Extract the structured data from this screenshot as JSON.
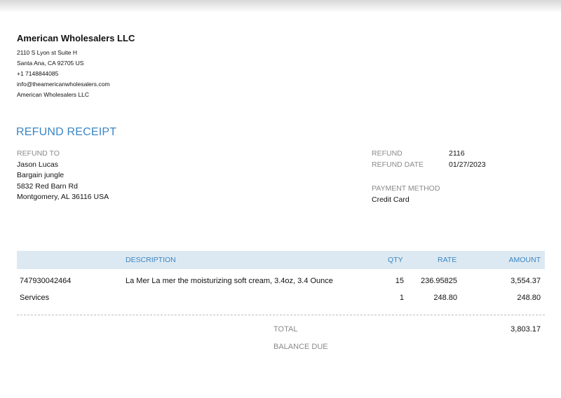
{
  "company": {
    "name": "American Wholesalers LLC",
    "address1": "2110 S Lyon st Suite H",
    "address2": "Santa Ana, CA  92705 US",
    "phone": "+1 7148844085",
    "email": "info@theamericanwholesalers.com",
    "name2": "American Wholesalers LLC"
  },
  "document": {
    "title": "REFUND RECEIPT"
  },
  "refund_to": {
    "label": "REFUND TO",
    "name": "Jason Lucas",
    "company": "Bargain jungle",
    "street": "5832 Red Barn Rd",
    "city": "Montgomery, AL  36116 USA"
  },
  "meta": {
    "refund_label": "REFUND",
    "refund_value": "2116",
    "date_label": "REFUND DATE",
    "date_value": "01/27/2023",
    "payment_label": "PAYMENT METHOD",
    "payment_value": "Credit Card"
  },
  "table": {
    "headers": {
      "description": "DESCRIPTION",
      "qty": "QTY",
      "rate": "RATE",
      "amount": "AMOUNT"
    },
    "rows": [
      {
        "sku": "747930042464",
        "description": "La Mer La mer the moisturizing soft cream, 3.4oz, 3.4 Ounce",
        "qty": "15",
        "rate": "236.95825",
        "amount": "3,554.37"
      },
      {
        "sku": "Services",
        "description": "",
        "qty": "1",
        "rate": "248.80",
        "amount": "248.80"
      }
    ]
  },
  "totals": {
    "total_label": "TOTAL",
    "total_value": "3,803.17",
    "balance_label": "BALANCE DUE",
    "balance_value": ""
  },
  "colors": {
    "accent": "#3a86c4",
    "header_bg": "#dde9f2",
    "muted_label": "#8a8a8a"
  }
}
